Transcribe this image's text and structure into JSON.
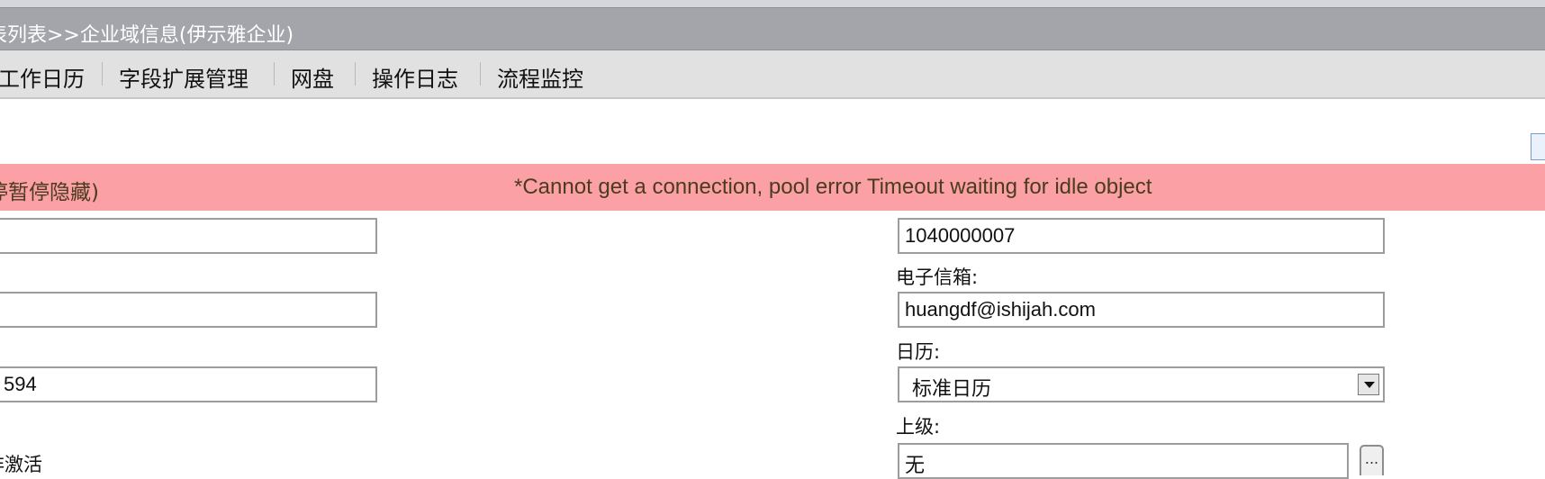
{
  "breadcrumb": {
    "text": "表列表>>企业域信息(伊示雅企业)"
  },
  "nav": {
    "items": [
      "工作日历",
      "字段扩展管理",
      "网盘",
      "操作日志",
      "流程监控"
    ]
  },
  "error": {
    "left_text": "停暂停隐藏)",
    "message": "*Cannot get a connection, pool error Timeout waiting for idle object"
  },
  "left_form": {
    "field1_value": "",
    "field2_value": "",
    "field3_value": "594",
    "status_text": "非激活"
  },
  "right_form": {
    "id_value": "1040000007",
    "email_label": "电子信箱:",
    "email_value": "huangdf@ishijah.com",
    "calendar_label": "日历:",
    "calendar_value": "标准日历",
    "parent_label": "上级:",
    "parent_value": "无",
    "more_label": "..."
  },
  "icons": {
    "corner": "document-icon",
    "dropdown": "chevron-down-icon"
  }
}
